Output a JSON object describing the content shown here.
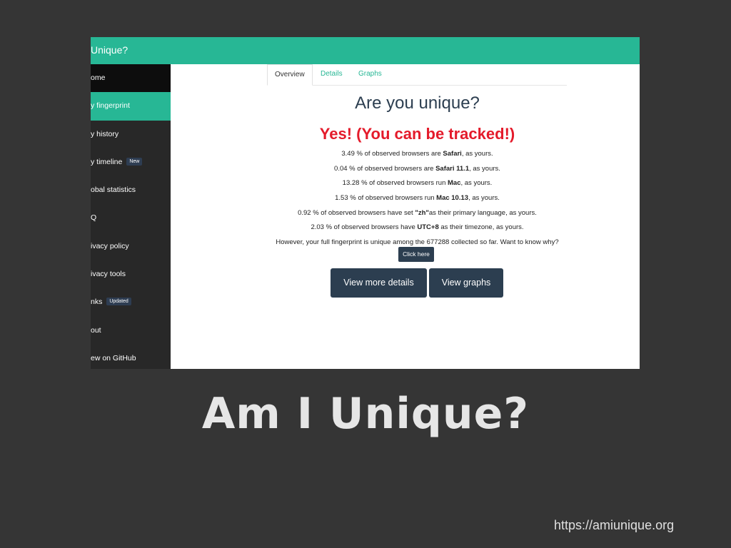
{
  "app": {
    "brand": "Unique?"
  },
  "sidebar": {
    "items": [
      {
        "label": "ome"
      },
      {
        "label": "y fingerprint"
      },
      {
        "label": "y history"
      },
      {
        "label": "y timeline",
        "badge": "New"
      },
      {
        "label": "obal statistics"
      },
      {
        "label": "Q"
      },
      {
        "label": "ivacy policy"
      },
      {
        "label": "ivacy tools"
      },
      {
        "label": "nks",
        "badge": "Updated"
      },
      {
        "label": "out"
      },
      {
        "label": "ew on GitHub"
      }
    ]
  },
  "tabs": [
    {
      "label": "Overview"
    },
    {
      "label": "Details"
    },
    {
      "label": "Graphs"
    }
  ],
  "main": {
    "heading": "Are you unique?",
    "verdict": "Yes! (You can be tracked!)",
    "stats": [
      {
        "pre": "3.49 % of observed browsers are ",
        "bold": "Safari",
        "post": ", as yours."
      },
      {
        "pre": "0.04 % of observed browsers are ",
        "bold": "Safari 11.1",
        "post": ", as yours."
      },
      {
        "pre": "13.28 % of observed browsers run ",
        "bold": "Mac",
        "post": ", as yours."
      },
      {
        "pre": "1.53 % of observed browsers run ",
        "bold": "Mac 10.13",
        "post": ", as yours."
      },
      {
        "pre": "0.92 % of observed browsers have set ",
        "bold": "\"zh\"",
        "post": "as their primary language, as yours."
      },
      {
        "pre": "2.03 % of observed browsers have ",
        "bold": "UTC+8",
        "post": " as their timezone, as yours."
      }
    ],
    "unique_line": "However, your full fingerprint is unique among the 677288 collected so far. Want to know why?",
    "click_here": "Click here",
    "view_details": "View more details",
    "view_graphs": "View graphs"
  },
  "slide": {
    "title": "Am I Unique?",
    "url": "https://amiunique.org"
  },
  "colors": {
    "accent": "#27b795",
    "sidebar_bg": "#282828",
    "button": "#2c3e50",
    "alert": "#e41b2b",
    "slide_bg": "#353535"
  }
}
